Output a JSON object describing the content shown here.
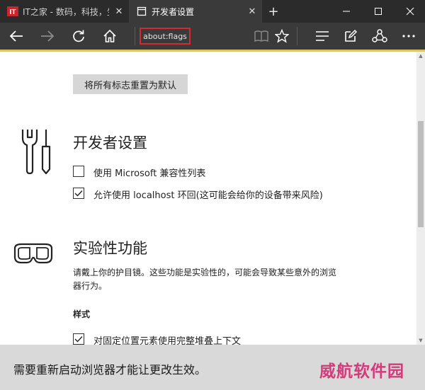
{
  "tabs": [
    {
      "favicon_text": "IT",
      "title": "IT之家 - 数码，科技，生活 -",
      "close": "✕",
      "active": false
    },
    {
      "title": "开发者设置",
      "close": "✕",
      "active": true
    }
  ],
  "new_tab": "+",
  "address": "about:flags",
  "reset_button": "将所有标志重置为默认",
  "developer": {
    "heading": "开发者设置",
    "options": [
      {
        "label": "使用 Microsoft 兼容性列表",
        "checked": false
      },
      {
        "label": "允许使用 localhost 环回(这可能会给你的设备带来风险)",
        "checked": true
      }
    ]
  },
  "experimental": {
    "heading": "实验性功能",
    "description": "请戴上你的护目镜。这些功能是实验性的，可能会导致某些意外的浏览器行为。",
    "subheading": "样式",
    "options": [
      {
        "label": "对固定位置元素使用完整堆叠上下文",
        "checked": true
      }
    ]
  },
  "notice": "需要重新启动浏览器才能让更改生效。",
  "watermark": "威航软件园",
  "colors": {
    "accent_highlight": "#d62930",
    "watermark": "#d23c7a",
    "chrome": "#2b2b2b"
  }
}
